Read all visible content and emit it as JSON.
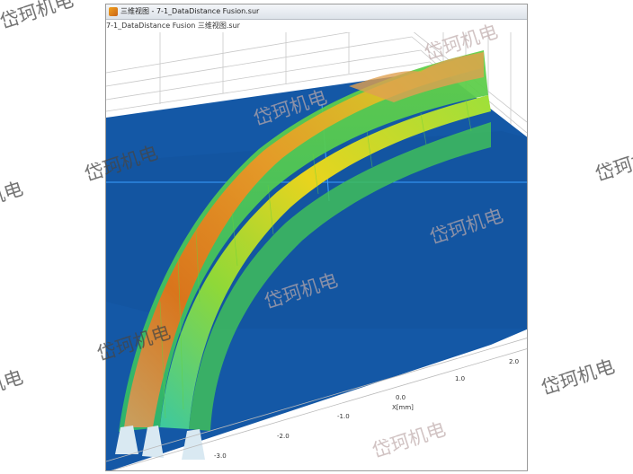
{
  "window": {
    "title": "三维视图 - 7-1_DataDistance Fusion.sur",
    "tab": "7-1_DataDistance Fusion 三维视图.sur"
  },
  "axis": {
    "label": "X[mm]",
    "ticks": [
      "-3.0",
      "-2.0",
      "-1.0",
      "0.0",
      "1.0",
      "2.0"
    ]
  },
  "watermark": {
    "text": "岱珂机电"
  },
  "colors": {
    "plane": "#1458a6",
    "grid": "#c8c8c8",
    "crosshair": "#3aa0ff"
  }
}
